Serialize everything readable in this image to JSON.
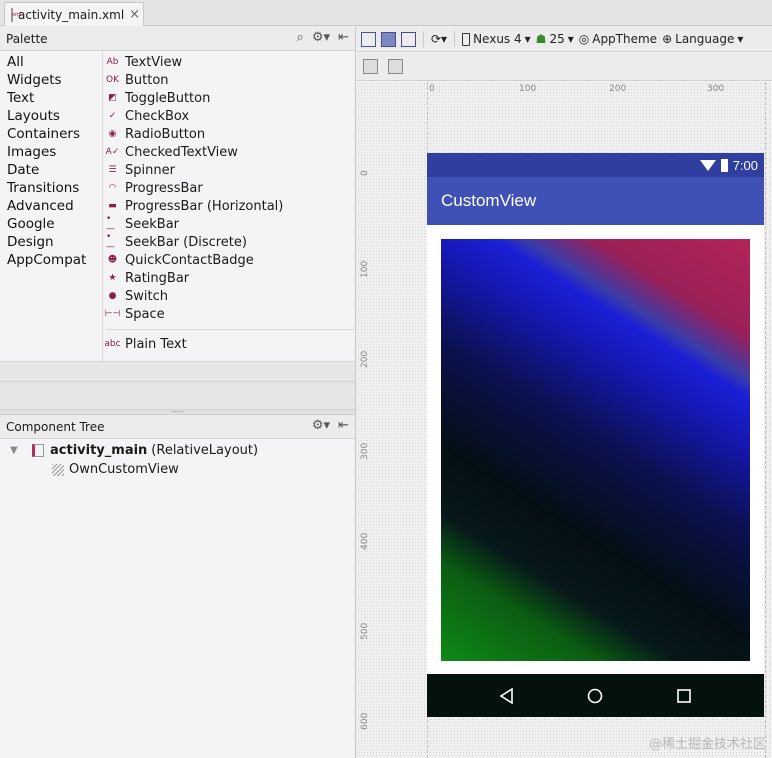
{
  "tab": {
    "title": "activity_main.xml",
    "close": "×"
  },
  "palette": {
    "title": "Palette",
    "categories": [
      "All",
      "Widgets",
      "Text",
      "Layouts",
      "Containers",
      "Images",
      "Date",
      "Transitions",
      "Advanced",
      "Google",
      "Design",
      "AppCompat"
    ],
    "widgets": [
      {
        "label": "TextView",
        "icon": "textview-icon",
        "glyph": "Ab"
      },
      {
        "label": "Button",
        "icon": "button-icon",
        "glyph": "OK"
      },
      {
        "label": "ToggleButton",
        "icon": "togglebutton-icon",
        "glyph": "◩"
      },
      {
        "label": "CheckBox",
        "icon": "checkbox-icon",
        "glyph": "✓"
      },
      {
        "label": "RadioButton",
        "icon": "radiobutton-icon",
        "glyph": "◉"
      },
      {
        "label": "CheckedTextView",
        "icon": "checkedtextview-icon",
        "glyph": "A✓"
      },
      {
        "label": "Spinner",
        "icon": "spinner-icon",
        "glyph": "☰"
      },
      {
        "label": "ProgressBar",
        "icon": "progressbar-icon",
        "glyph": "◠"
      },
      {
        "label": "ProgressBar (Horizontal)",
        "icon": "progressbar-horizontal-icon",
        "glyph": "▬"
      },
      {
        "label": "SeekBar",
        "icon": "seekbar-icon",
        "glyph": "•—"
      },
      {
        "label": "SeekBar (Discrete)",
        "icon": "seekbar-discrete-icon",
        "glyph": "•—"
      },
      {
        "label": "QuickContactBadge",
        "icon": "quickcontactbadge-icon",
        "glyph": "☻"
      },
      {
        "label": "RatingBar",
        "icon": "ratingbar-icon",
        "glyph": "★"
      },
      {
        "label": "Switch",
        "icon": "switch-icon",
        "glyph": "●"
      },
      {
        "label": "Space",
        "icon": "space-icon",
        "glyph": "⊢⊣"
      }
    ],
    "text_section": [
      {
        "label": "Plain Text",
        "icon": "plaintext-icon",
        "glyph": "abc"
      }
    ]
  },
  "component_tree": {
    "title": "Component Tree",
    "root": {
      "name": "activity_main",
      "type": "(RelativeLayout)"
    },
    "children": [
      "OwnCustomView"
    ]
  },
  "toolbar": {
    "device": "Nexus 4",
    "api": "25",
    "theme": "AppTheme",
    "language": "Language"
  },
  "ruler": {
    "top": [
      "0",
      "100",
      "200",
      "300"
    ],
    "left": [
      "0",
      "100",
      "200",
      "300",
      "400",
      "500",
      "600"
    ]
  },
  "device_screen": {
    "time": "7:00",
    "app_title": "CustomView"
  },
  "watermark": "@稀土掘金技术社区"
}
